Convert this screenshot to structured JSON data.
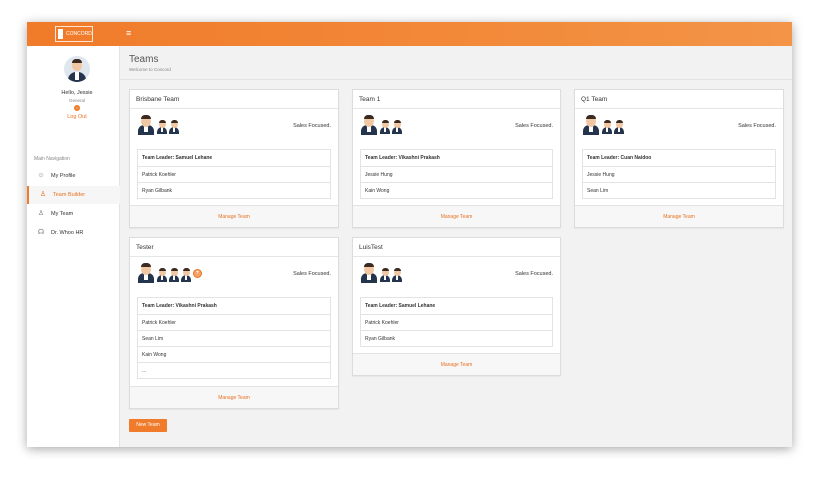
{
  "header": {
    "brand": "CONCORD",
    "menu_icon": "hamburger-icon"
  },
  "sidebar": {
    "greeting": "Hello, Jessie",
    "role": "General",
    "logout_label": "Log Out",
    "nav_heading": "Main Navigation",
    "items": [
      {
        "label": "My Profile",
        "icon": "user-icon",
        "active": false
      },
      {
        "label": "Team Builder",
        "icon": "team-builder-icon",
        "active": true
      },
      {
        "label": "My Team",
        "icon": "team-icon",
        "active": false
      },
      {
        "label": "Dr. Whoo HR",
        "icon": "headset-icon",
        "active": false
      }
    ]
  },
  "page": {
    "title": "Teams",
    "subtitle": "Welcome to Concord"
  },
  "teams": [
    {
      "name": "Brisbane Team",
      "focus": "Sales Focused.",
      "leader": "Team Leader: Samuel Lehane",
      "members": [
        "Patrick Koehler",
        "Ryan Gilbank"
      ],
      "action": "Manage Team"
    },
    {
      "name": "Team 1",
      "focus": "Sales Focused.",
      "leader": "Team Leader: Vikashni Prakash",
      "members": [
        "Jessie Hung",
        "Kain Wong"
      ],
      "action": "Manage Team"
    },
    {
      "name": "Q1 Team",
      "focus": "Sales Focused.",
      "leader": "Team Leader: Cuan Naidoo",
      "members": [
        "Jessie Hung",
        "Sean Lim"
      ],
      "action": "Manage Team"
    },
    {
      "name": "Tester",
      "focus": "Sales Focused.",
      "leader": "Team Leader: Vikashni Prakash",
      "members": [
        "Patrick Koehler",
        "Sean Lim",
        "Kain Wong",
        "..."
      ],
      "action": "Manage Team"
    },
    {
      "name": "LuisTest",
      "focus": "Sales Focused.",
      "leader": "Team Leader: Samuel Lehane",
      "members": [
        "Patrick Koehler",
        "Ryan Gilbank"
      ],
      "action": "Manage Team"
    }
  ],
  "new_team_label": "New Team",
  "colors": {
    "accent": "#f07b2a",
    "navy": "#24344d"
  }
}
